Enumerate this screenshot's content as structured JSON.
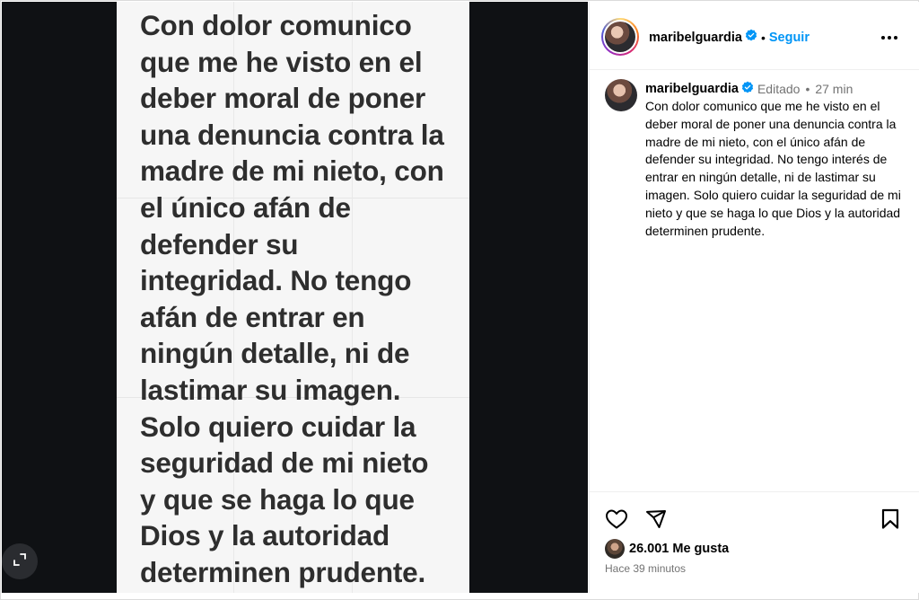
{
  "media": {
    "text": "Con dolor comunico\nque me he visto en el\ndeber moral de poner\nuna denuncia contra la\nmadre de mi nieto, con\nel único afán de\ndefender su\nintegridad.  No tengo\nafán de entrar en\nningún detalle, ni de\nlastimar su imagen.\nSolo quiero cuidar la\nseguridad de mi nieto\ny que se haga lo que\nDios y la autoridad\ndeterminen prudente.",
    "expand_icon": "expand-icon"
  },
  "header": {
    "username": "maribelguardia",
    "separator": "•",
    "follow_label": "Seguir",
    "more_icon": "more-options-icon"
  },
  "caption": {
    "username": "maribelguardia",
    "edited_label": "Editado",
    "separator": "•",
    "time_ago": "27 min",
    "body": "Con dolor comunico que me he visto en el deber moral de poner una denuncia contra la madre de mi nieto, con el único afán de defender su integridad. No tengo interés de entrar en ningún detalle, ni de lastimar su imagen. Solo quiero cuidar la seguridad de mi nieto y que se haga lo que Dios y la autoridad determinen prudente."
  },
  "actions": {
    "like_icon": "heart-icon",
    "share_icon": "share-icon",
    "save_icon": "bookmark-icon",
    "likes_text": "26.001 Me gusta",
    "posted_time": "Hace 39 minutos"
  },
  "colors": {
    "accent": "#0095f6",
    "verified": "#0095f6",
    "muted": "#737373",
    "media_background": "#0f1114"
  }
}
